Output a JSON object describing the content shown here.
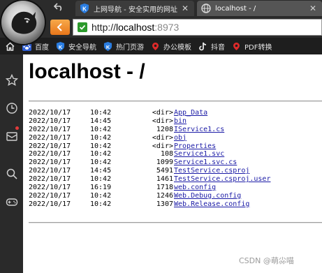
{
  "tabs": [
    {
      "label": "上网导航 - 安全实用的网址",
      "close": "✕",
      "active": false
    },
    {
      "label": "localhost - /",
      "close": "✕",
      "active": true
    }
  ],
  "address": {
    "scheme": "http://",
    "host": "localhost",
    "port": ":8973"
  },
  "bookmarks": [
    {
      "label": "百度",
      "icon": "baidu-paw-icon"
    },
    {
      "label": "安全导航",
      "icon": "shield-k-icon"
    },
    {
      "label": "热门页游",
      "icon": "shield-k-icon"
    },
    {
      "label": "办公模板",
      "icon": "red-glyph-icon"
    },
    {
      "label": "抖音",
      "icon": "douyin-note-icon"
    },
    {
      "label": "PDF转换",
      "icon": "red-glyph-icon"
    }
  ],
  "page": {
    "title": "localhost - /"
  },
  "listing": [
    {
      "date": "2022/10/17",
      "time": "10:42",
      "size": "<dir>",
      "name": "App_Data"
    },
    {
      "date": "2022/10/17",
      "time": "14:45",
      "size": "<dir>",
      "name": "bin"
    },
    {
      "date": "2022/10/17",
      "time": "10:42",
      "size": "1208",
      "name": "IService1.cs"
    },
    {
      "date": "2022/10/17",
      "time": "10:42",
      "size": "<dir>",
      "name": "obj"
    },
    {
      "date": "2022/10/17",
      "time": "10:42",
      "size": "<dir>",
      "name": "Properties"
    },
    {
      "date": "2022/10/17",
      "time": "10:42",
      "size": "108",
      "name": "Service1.svc"
    },
    {
      "date": "2022/10/17",
      "time": "10:42",
      "size": "1099",
      "name": "Service1.svc.cs"
    },
    {
      "date": "2022/10/17",
      "time": "14:45",
      "size": "5491",
      "name": "TestService.csproj"
    },
    {
      "date": "2022/10/17",
      "time": "10:42",
      "size": "1461",
      "name": "TestService.csproj.user"
    },
    {
      "date": "2022/10/17",
      "time": "16:19",
      "size": "1718",
      "name": "web.config"
    },
    {
      "date": "2022/10/17",
      "time": "10:42",
      "size": "1246",
      "name": "Web.Debug.config"
    },
    {
      "date": "2022/10/17",
      "time": "10:42",
      "size": "1307",
      "name": "Web.Release.config"
    }
  ],
  "watermark": "CSDN @萌尛喵",
  "colors": {
    "accent_orange": "#e8761a",
    "secure_green": "#2c9a2c",
    "link_blue": "#1a1aa6",
    "chrome_dark": "#2b2b2b"
  }
}
